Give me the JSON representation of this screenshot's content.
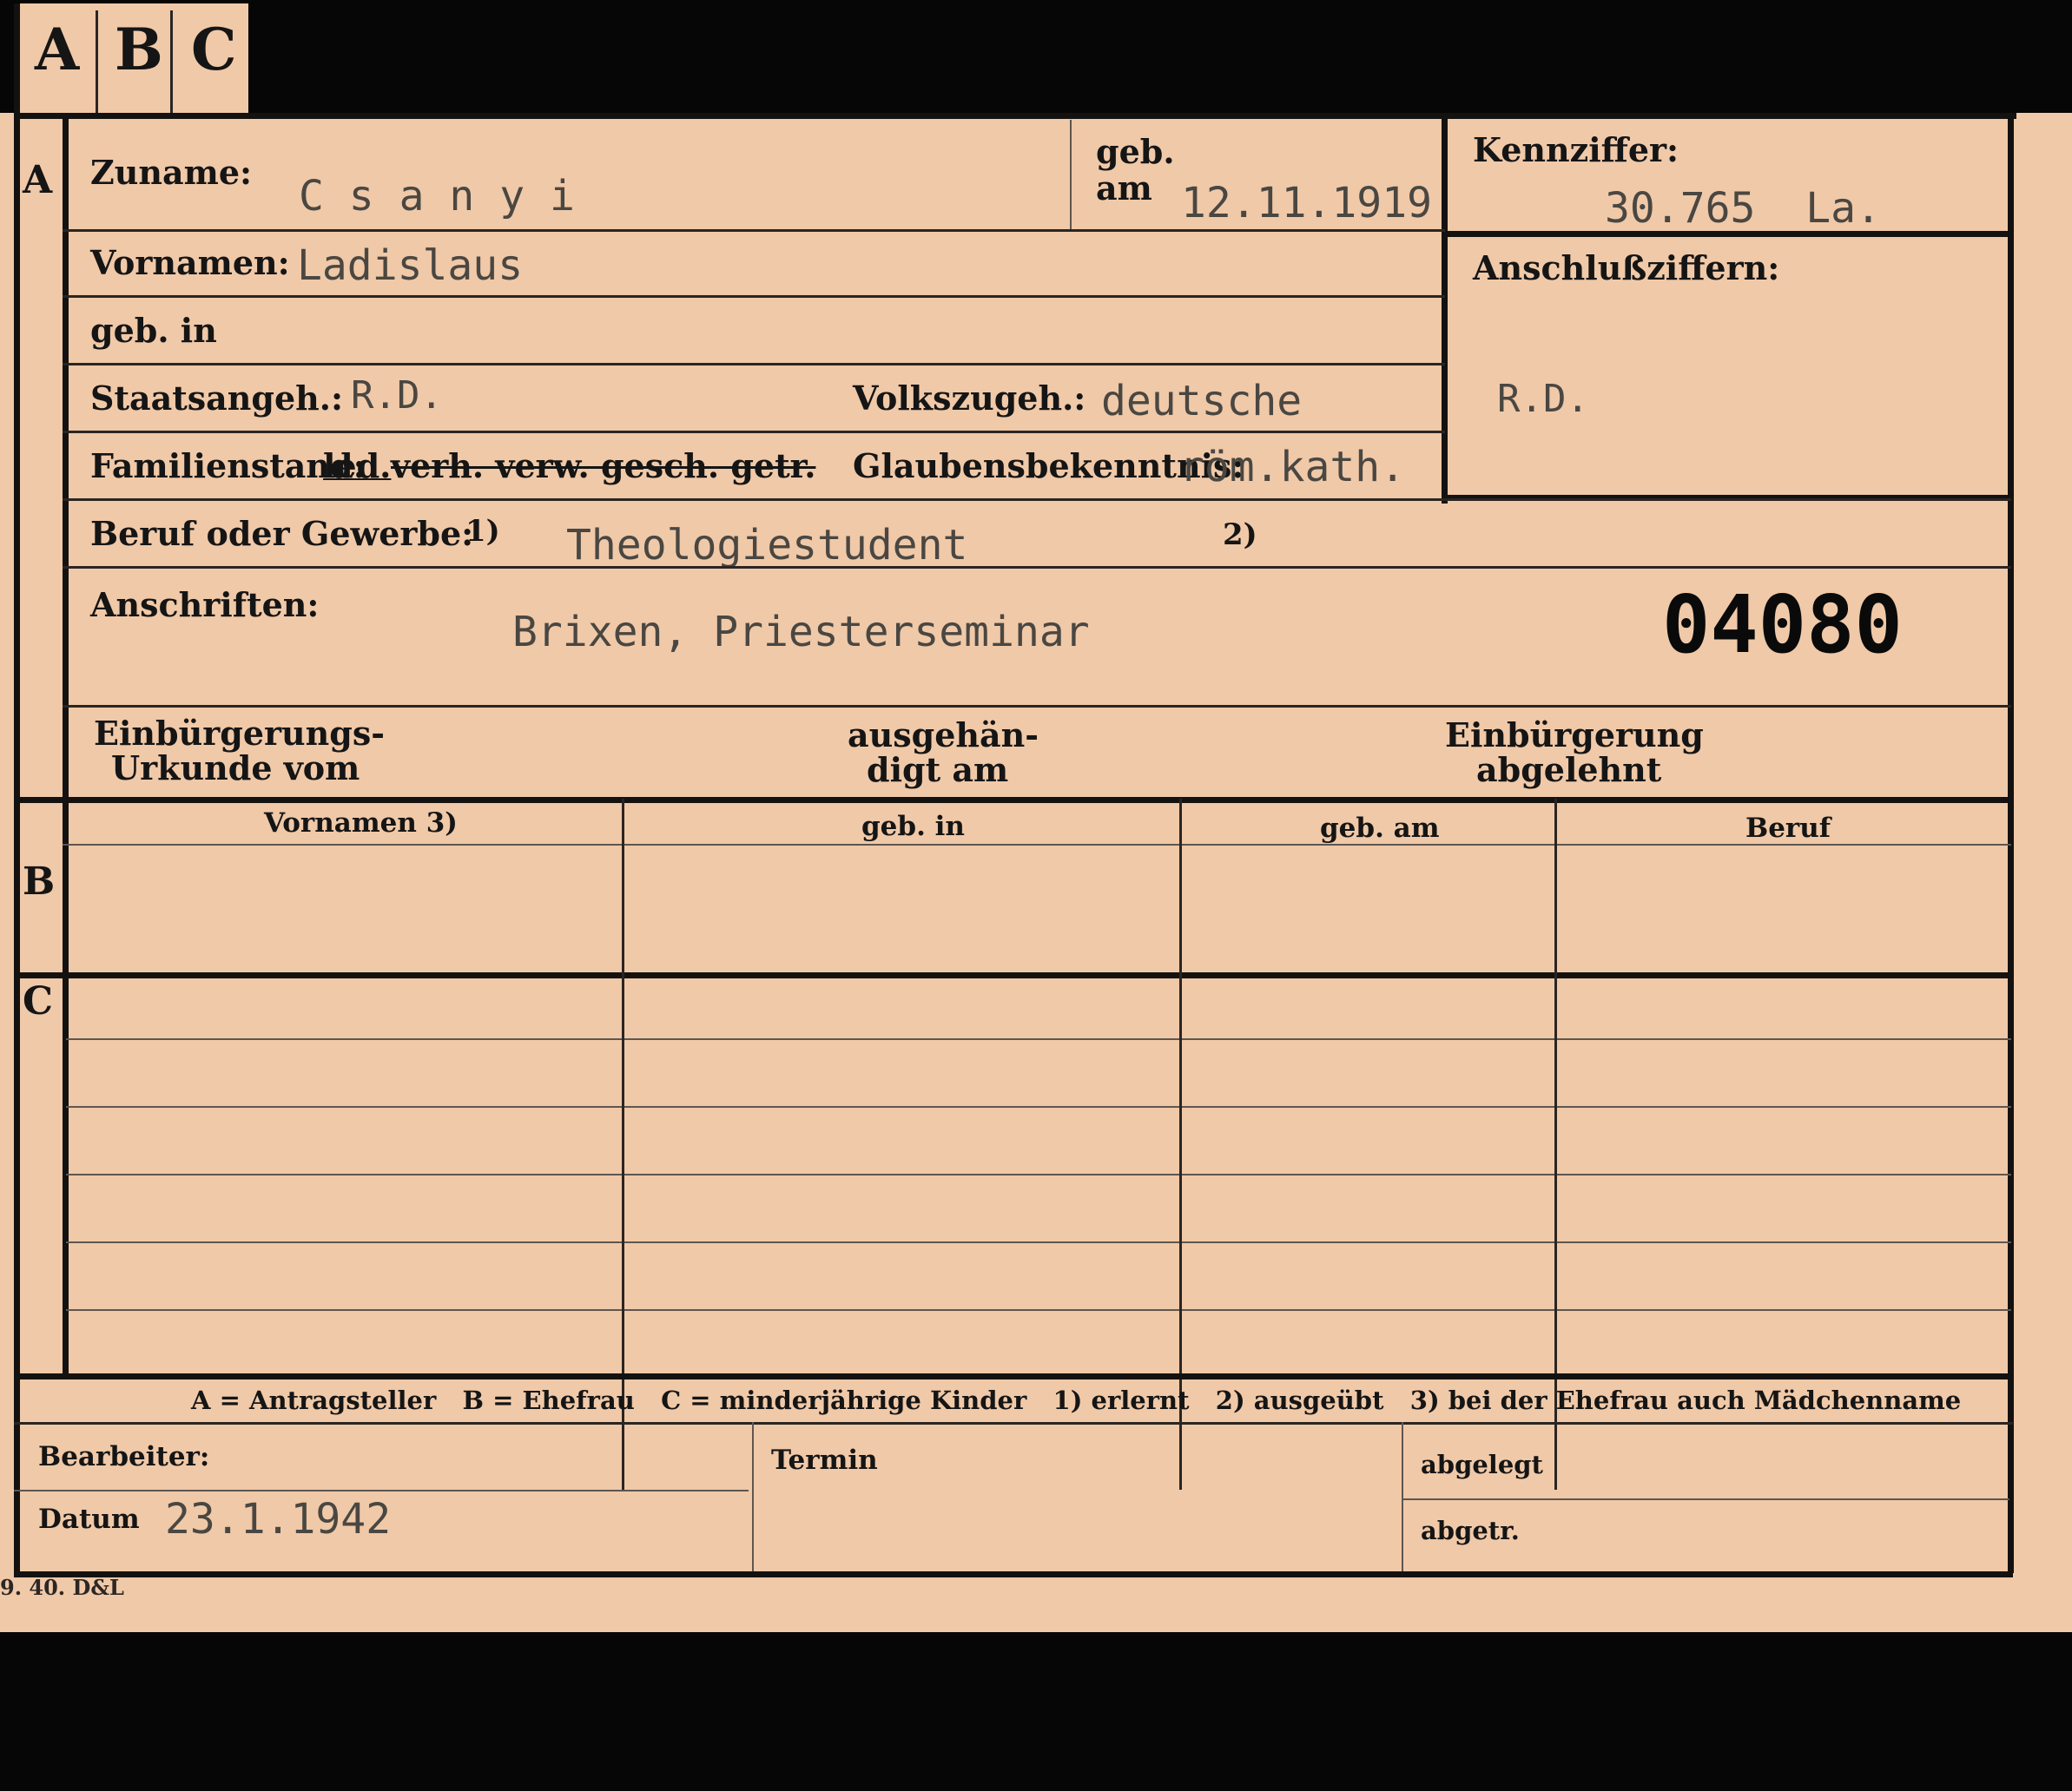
{
  "tabs": [
    "A",
    "B",
    "C"
  ],
  "section_markers": {
    "a": "A",
    "b": "B",
    "c": "C"
  },
  "surname": {
    "label": "Zuname:",
    "value": "C s a n y i"
  },
  "birth_date": {
    "label_top": "geb.",
    "label_bottom": "am",
    "value": "12.11.1919"
  },
  "id_number": {
    "label": "Kennziffer:",
    "value": "30.765  La."
  },
  "connection_numbers": {
    "label": "Anschlußziffern:",
    "value": "R.D."
  },
  "first_names": {
    "label": "Vornamen:",
    "value": "Ladislaus"
  },
  "birth_place": {
    "label": "geb. in"
  },
  "citizenship": {
    "label": "Staatsangeh.:",
    "value": "R.D."
  },
  "ethnicity": {
    "label": "Volkszugeh.:",
    "value": "deutsche"
  },
  "marital_status": {
    "label": "Familienstand:",
    "selected": "led.",
    "struck": "verh. verw. gesch. getr."
  },
  "religion": {
    "label": "Glaubensbekenntnis:",
    "value": "röm.kath."
  },
  "occupation": {
    "label": "Beruf oder Gewerbe:",
    "note1": "1)",
    "value": "Theologiestudent",
    "note2": "2)"
  },
  "addresses": {
    "label": "Anschriften:",
    "value": "Brixen, Priesterseminar"
  },
  "stamp_number": "04080",
  "naturalization": {
    "certificate_line1": "Einbürgerungs-",
    "certificate_line2": "Urkunde vom",
    "handed_line1": "ausgehän-",
    "handed_line2": "digt am",
    "rejected_line1": "Einbürgerung",
    "rejected_line2": "abgelehnt"
  },
  "table_headers": [
    "Vornamen 3)",
    "geb. in",
    "geb. am",
    "Beruf"
  ],
  "legend": "A = Antragsteller   B = Ehefrau   C = minderjährige Kinder   1) erlernt   2) ausgeübt   3) bei der Ehefrau auch Mädchenname",
  "footer": {
    "clerk_label": "Bearbeiter:",
    "date_label": "Datum",
    "date_value": "23.1.1942",
    "term_label": "Termin",
    "filed_label": "abgelegt",
    "sent_label": "abgetr."
  },
  "print_code": "9. 40. D&L"
}
